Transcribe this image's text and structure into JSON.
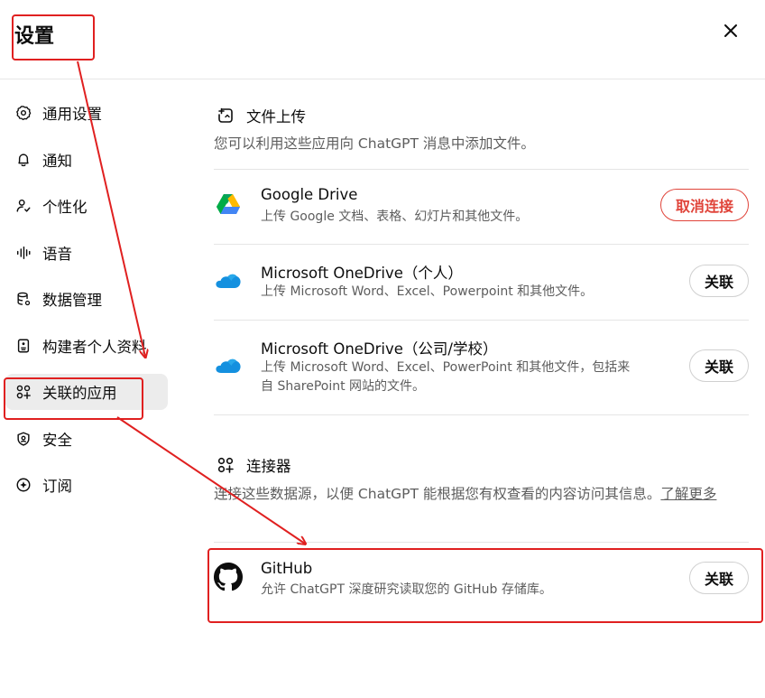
{
  "header": {
    "title": "设置"
  },
  "sidebar": {
    "items": [
      {
        "label": "通用设置",
        "icon": "gear-icon"
      },
      {
        "label": "通知",
        "icon": "bell-icon"
      },
      {
        "label": "个性化",
        "icon": "personalization-icon"
      },
      {
        "label": "语音",
        "icon": "waveform-icon"
      },
      {
        "label": "数据管理",
        "icon": "database-icon"
      },
      {
        "label": "构建者个人资料",
        "icon": "profile-card-icon"
      },
      {
        "label": "关联的应用",
        "icon": "apps-icon",
        "active": true
      },
      {
        "label": "安全",
        "icon": "shield-icon"
      },
      {
        "label": "订阅",
        "icon": "subscription-icon"
      }
    ]
  },
  "file_upload": {
    "title": "文件上传",
    "description": "您可以利用这些应用向 ChatGPT 消息中添加文件。",
    "apps": [
      {
        "name": "Google Drive",
        "description": "上传 Google 文档、表格、幻灯片和其他文件。",
        "button": "取消连接"
      },
      {
        "name": "Microsoft OneDrive（个人）",
        "description": "上传 Microsoft Word、Excel、Powerpoint 和其他文件。",
        "button": "关联"
      },
      {
        "name": "Microsoft OneDrive（公司/学校）",
        "description_line1": "上传 Microsoft Word、Excel、PowerPoint 和其他文件，包括来",
        "description_line2": "自 SharePoint 网站的文件。",
        "button": "关联"
      }
    ]
  },
  "connectors": {
    "title": "连接器",
    "description": "连接这些数据源，以便 ChatGPT 能根据您有权查看的内容访问其信息。",
    "learn_more": "了解更多",
    "apps": [
      {
        "name": "GitHub",
        "description": "允许 ChatGPT 深度研究读取您的 GitHub 存储库。",
        "button": "关联"
      }
    ]
  },
  "colors": {
    "annotation": "#e02020",
    "danger": "#e0443a",
    "active_bg": "#ececec"
  }
}
